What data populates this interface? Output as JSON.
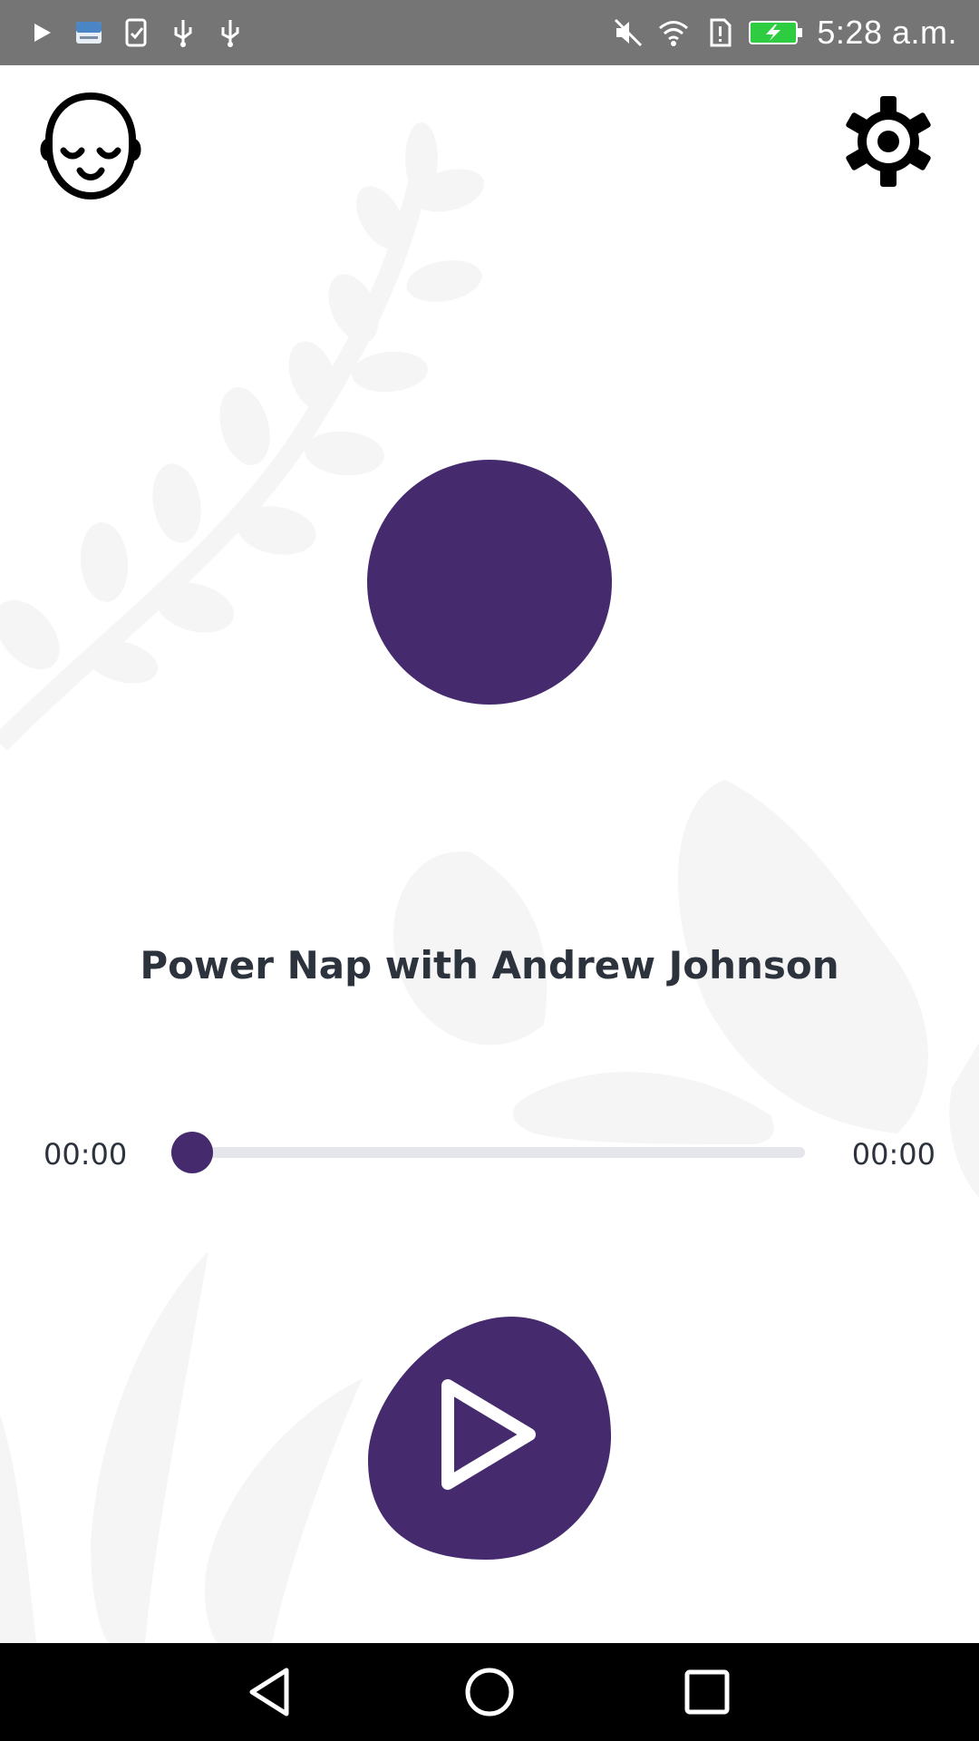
{
  "status_bar": {
    "time": "5:28 a.m.",
    "icons_left": [
      "play-icon",
      "app-notification-icon",
      "checklist-icon",
      "usb-icon",
      "usb-icon"
    ],
    "icons_right": [
      "mute-icon",
      "wifi-icon",
      "sim-alert-icon",
      "battery-charging-icon"
    ]
  },
  "header": {
    "left_icon": "sleeping-face-icon",
    "right_icon": "gear-icon"
  },
  "player": {
    "track_title": "Power Nap with Andrew Johnson",
    "elapsed": "00:00",
    "duration": "00:00",
    "progress_fraction": 0,
    "play_icon": "play-icon"
  },
  "colors": {
    "accent": "#452b6e",
    "text": "#2d333d",
    "track": "#e4e6eb",
    "status_bar": "#757575",
    "nav_bar": "#000000",
    "battery": "#2ecc40"
  },
  "nav": {
    "icons": [
      "back-icon",
      "home-icon",
      "recents-icon"
    ]
  }
}
